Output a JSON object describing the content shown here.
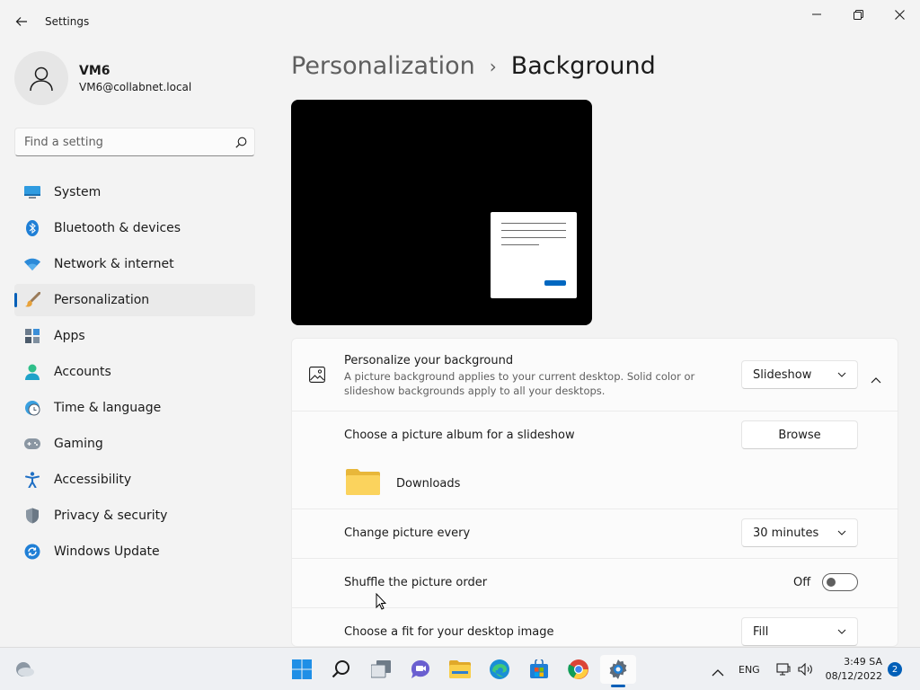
{
  "window": {
    "title": "Settings",
    "accent_color": "#005fb8"
  },
  "profile": {
    "name": "VM6",
    "email": "VM6@collabnet.local"
  },
  "search": {
    "placeholder": "Find a setting"
  },
  "sidebar": {
    "items": [
      {
        "label": "System",
        "icon": "system-icon",
        "active": false
      },
      {
        "label": "Bluetooth & devices",
        "icon": "bluetooth-icon",
        "active": false
      },
      {
        "label": "Network & internet",
        "icon": "wifi-icon",
        "active": false
      },
      {
        "label": "Personalization",
        "icon": "paintbrush-icon",
        "active": true
      },
      {
        "label": "Apps",
        "icon": "apps-icon",
        "active": false
      },
      {
        "label": "Accounts",
        "icon": "accounts-icon",
        "active": false
      },
      {
        "label": "Time & language",
        "icon": "clock-globe-icon",
        "active": false
      },
      {
        "label": "Gaming",
        "icon": "gamepad-icon",
        "active": false
      },
      {
        "label": "Accessibility",
        "icon": "accessibility-icon",
        "active": false
      },
      {
        "label": "Privacy & security",
        "icon": "shield-icon",
        "active": false
      },
      {
        "label": "Windows Update",
        "icon": "update-icon",
        "active": false
      }
    ]
  },
  "breadcrumb": {
    "parent": "Personalization",
    "separator": "›",
    "current": "Background"
  },
  "settings": {
    "personalize": {
      "title": "Personalize your background",
      "description": "A picture background applies to your current desktop. Solid color or slideshow backgrounds apply to all your desktops.",
      "value": "Slideshow"
    },
    "album": {
      "title": "Choose a picture album for a slideshow",
      "button": "Browse",
      "folder": "Downloads"
    },
    "interval": {
      "title": "Change picture every",
      "value": "30 minutes"
    },
    "shuffle": {
      "title": "Shuffle the picture order",
      "state": "Off"
    },
    "fit": {
      "title": "Choose a fit for your desktop image",
      "value": "Fill"
    }
  },
  "taskbar": {
    "language": "ENG",
    "time": "3:49 SA",
    "date": "08/12/2022",
    "notifications": "2"
  }
}
